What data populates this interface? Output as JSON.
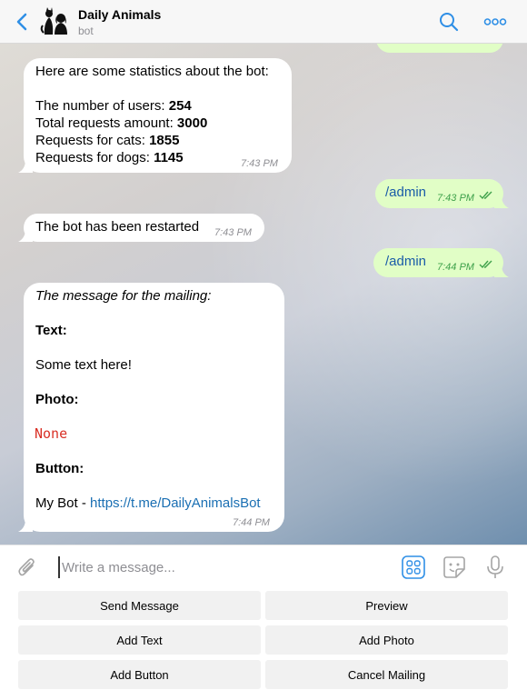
{
  "header": {
    "title": "Daily Animals",
    "subtitle": "bot"
  },
  "messages": {
    "stats": {
      "intro": "Here are some statistics about the bot:",
      "users_label": "The number of users: ",
      "users_value": "254",
      "total_label": "Total requests amount: ",
      "total_value": "3000",
      "cats_label": "Requests for cats: ",
      "cats_value": "1855",
      "dogs_label": "Requests for dogs: ",
      "dogs_value": "1145",
      "time": "7:43 PM"
    },
    "admin1": {
      "text": "/admin",
      "time": "7:43 PM"
    },
    "restarted": {
      "text": "The bot has been restarted",
      "time": "7:43 PM"
    },
    "admin2": {
      "text": "/admin",
      "time": "7:44 PM"
    },
    "mailing": {
      "heading": "The message for the mailing:",
      "text_label": "Text:",
      "text_value": "Some text here!",
      "photo_label": "Photo:",
      "photo_value": "None",
      "button_label": "Button:",
      "button_prefix": "My Bot - ",
      "button_link": "https://t.me/DailyAnimalsBot",
      "time": "7:44 PM"
    }
  },
  "composer": {
    "placeholder": "Write a message..."
  },
  "keyboard": {
    "send_message": "Send Message",
    "preview": "Preview",
    "add_text": "Add Text",
    "add_photo": "Add Photo",
    "add_button": "Add Button",
    "cancel_mailing": "Cancel Mailing"
  },
  "colors": {
    "accent": "#2f8fe6",
    "outgoing_bubble": "#e1fec6",
    "none_red": "#d93025",
    "link": "#1a6fb3"
  }
}
